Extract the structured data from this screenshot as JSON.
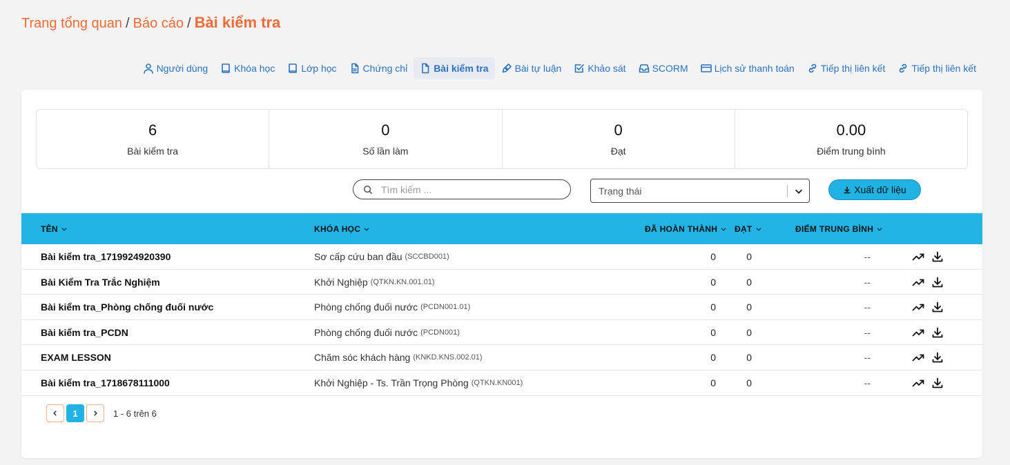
{
  "breadcrumb": {
    "items": [
      "Trang tổng quan",
      "Báo cáo"
    ],
    "current": "Bài kiểm tra",
    "separator": "/"
  },
  "tabs": [
    {
      "label": "Người dùng",
      "icon": "user-icon"
    },
    {
      "label": "Khóa học",
      "icon": "book-icon"
    },
    {
      "label": "Lớp học",
      "icon": "book-icon"
    },
    {
      "label": "Chứng chỉ",
      "icon": "document-icon"
    },
    {
      "label": "Bài kiểm tra",
      "icon": "document-icon",
      "active": true
    },
    {
      "label": "Bài tự luận",
      "icon": "pen-icon"
    },
    {
      "label": "Khảo sát",
      "icon": "checkbox-icon"
    },
    {
      "label": "SCORM",
      "icon": "inbox-icon"
    },
    {
      "label": "Lịch sử thanh toán",
      "icon": "credit-card-icon"
    },
    {
      "label": "Tiếp thị liên kết",
      "icon": "link-icon"
    },
    {
      "label": "Tiếp thị liên kết",
      "icon": "link-icon"
    }
  ],
  "stats": [
    {
      "value": "6",
      "label": "Bài kiểm tra"
    },
    {
      "value": "0",
      "label": "Số lần làm"
    },
    {
      "value": "0",
      "label": "Đạt"
    },
    {
      "value": "0.00",
      "label": "Điểm trung bình"
    }
  ],
  "search": {
    "placeholder": "Tìm kiếm ..."
  },
  "status_filter": {
    "placeholder": "Trạng thái"
  },
  "export_label": "Xuất dữ liệu",
  "table": {
    "headers": {
      "name": "TÊN",
      "course": "KHÓA HỌC",
      "completed": "ĐÃ HOÀN THÀNH",
      "passed": "ĐẠT",
      "avg": "ĐIỂM TRUNG BÌNH"
    },
    "rows": [
      {
        "name": "Bài kiểm tra_1719924920390",
        "course": "Sơ cấp cứu ban đầu",
        "code": "(SCCBD001)",
        "completed": "0",
        "passed": "0",
        "avg": "--"
      },
      {
        "name": "Bài Kiểm Tra Trắc Nghiệm",
        "course": "Khởi Nghiệp",
        "code": "(QTKN.KN.001.01)",
        "completed": "0",
        "passed": "0",
        "avg": "--"
      },
      {
        "name": "Bài kiểm tra_Phòng chống đuối nước",
        "course": "Phòng chống đuối nước",
        "code": "(PCDN001.01)",
        "completed": "0",
        "passed": "0",
        "avg": "--"
      },
      {
        "name": "Bài kiểm tra_PCDN",
        "course": "Phòng chống đuối nước",
        "code": "(PCDN001)",
        "completed": "0",
        "passed": "0",
        "avg": "--"
      },
      {
        "name": "EXAM LESSON",
        "course": "Chăm sóc khách hàng",
        "code": "(KNKD.KNS.002.01)",
        "completed": "0",
        "passed": "0",
        "avg": "--"
      },
      {
        "name": "Bài kiểm tra_1718678111000",
        "course": "Khởi Nghiệp - Ts. Trần Trọng Phòng",
        "code": "(QTKN.KN001)",
        "completed": "0",
        "passed": "0",
        "avg": "--"
      }
    ]
  },
  "pagination": {
    "current_page": "1",
    "info": "1 - 6 trên 6"
  },
  "colors": {
    "accent_orange": "#f06a35",
    "header_blue": "#22b4e5",
    "link_blue": "#2b72bd"
  }
}
